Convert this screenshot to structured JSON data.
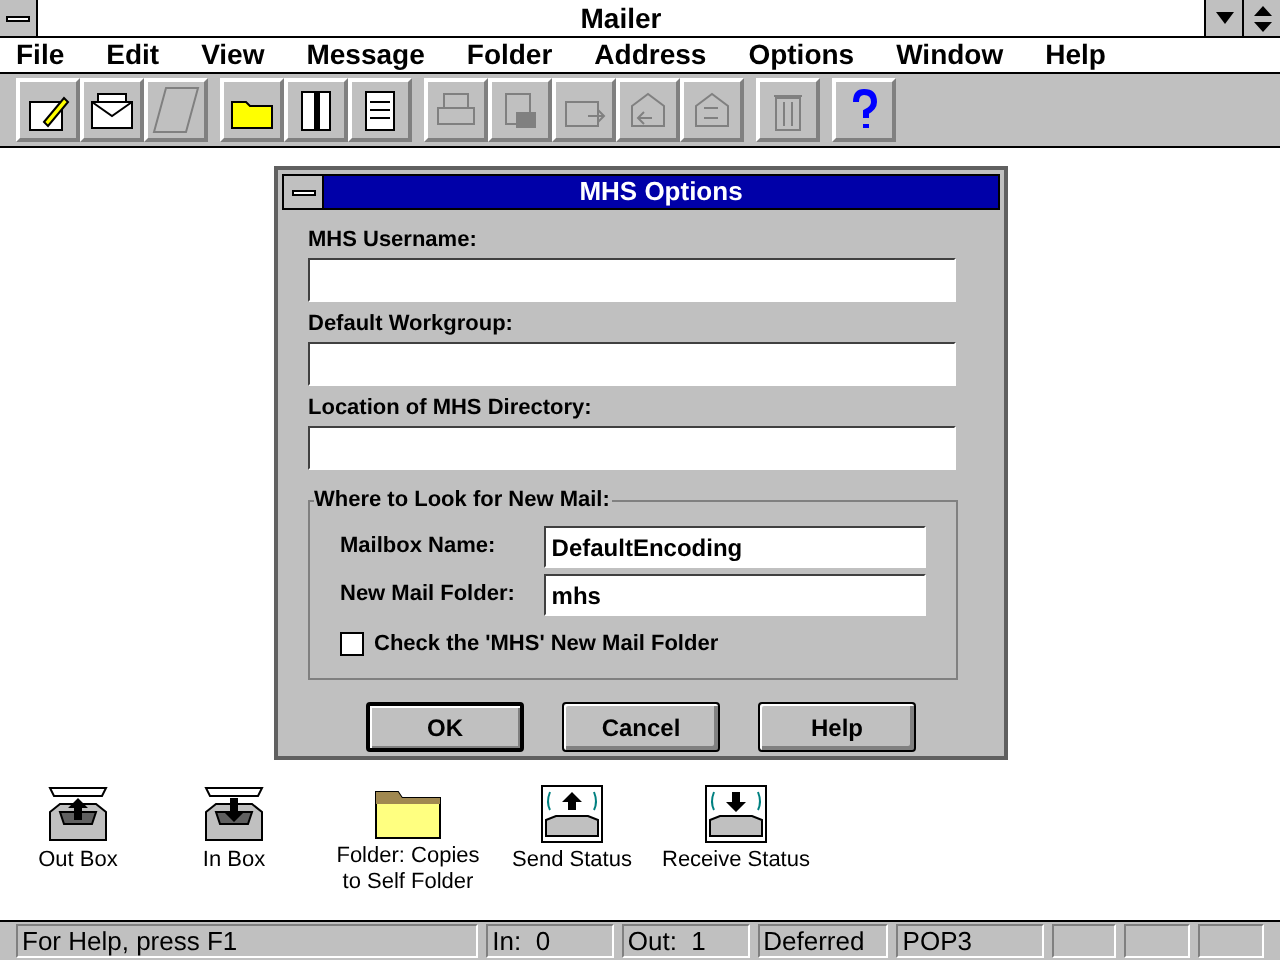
{
  "window": {
    "title": "Mailer"
  },
  "menu": [
    "File",
    "Edit",
    "View",
    "Message",
    "Folder",
    "Address",
    "Options",
    "Window",
    "Help"
  ],
  "toolbar": [
    {
      "disabled": false
    },
    {
      "disabled": false
    },
    {
      "disabled": true
    },
    {
      "disabled": false
    },
    {
      "disabled": false
    },
    {
      "disabled": false
    },
    {
      "disabled": true
    },
    {
      "disabled": true
    },
    {
      "disabled": true
    },
    {
      "disabled": true
    },
    {
      "disabled": true
    },
    {
      "disabled": true
    },
    {
      "disabled": false
    }
  ],
  "desktop_icons": [
    {
      "kind": "outbox",
      "label": "Out Box"
    },
    {
      "kind": "inbox",
      "label": "In Box"
    },
    {
      "kind": "folder",
      "label": "Folder: Copies to Self Folder"
    },
    {
      "kind": "send",
      "label": "Send Status"
    },
    {
      "kind": "receive",
      "label": "Receive Status"
    }
  ],
  "dialog": {
    "title": "MHS Options",
    "fields": [
      {
        "label": "MHS Username:"
      },
      {
        "label": "Default Workgroup:"
      },
      {
        "label": "Location of MHS Directory:"
      }
    ],
    "group": {
      "title": "Where to Look for New Mail:",
      "fields": [
        {
          "label": "Mailbox Name:",
          "value": "DefaultEncoding"
        },
        {
          "label": "New Mail Folder:",
          "value": "mhs"
        }
      ],
      "checkbox": {
        "label": "Check the 'MHS' New Mail Folder",
        "checked": false
      }
    },
    "buttons": [
      {
        "label": "OK",
        "default": true
      },
      {
        "label": "Cancel",
        "default": false
      },
      {
        "label": "Help",
        "default": false
      }
    ]
  },
  "status_bar": [
    "For Help, press F1",
    "In:  0",
    "Out:  1",
    "Deferred",
    "POP3"
  ]
}
